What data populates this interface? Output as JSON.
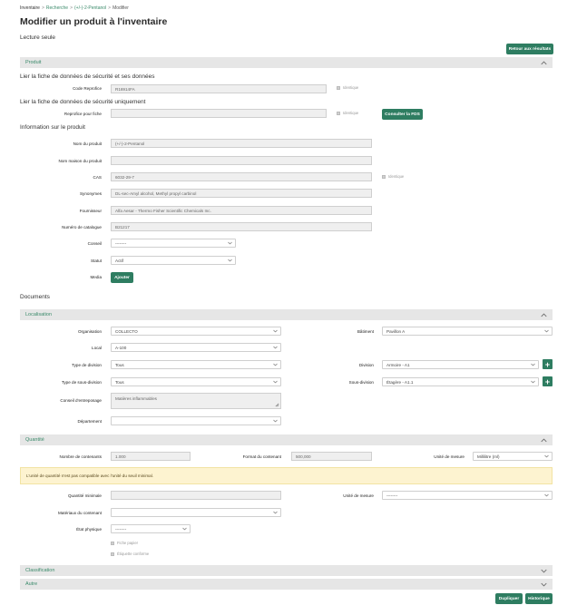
{
  "breadcrumb": {
    "items": [
      "Inventaire",
      "Recherche",
      "(+/-)-2-Pentanol"
    ],
    "current": "Modifier",
    "separator": ">"
  },
  "page": {
    "title": "Modifier un produit à l'inventaire",
    "subtitle": "Lecture seule",
    "back_button": "Retour aux résultats"
  },
  "produit": {
    "header": "Produit",
    "link_all": "Lier la fiche de données de sécurité et ses données",
    "code_reprofice_label": "Code Reprofice",
    "code_reprofice_value": "R16914FA",
    "identique": "Identique",
    "link_only": "Lier la fiche de données de sécurité uniquement",
    "reprofice_sds_label": "Reprofice pour fiche",
    "reprofice_sds_value": "",
    "consult_button": "Consulter la FDS",
    "info_title": "Information sur le produit",
    "fields": {
      "nom_label": "Nom du produit",
      "nom_value": "(+/-)-2-Pentanol",
      "maison_label": "Nom maison du produit",
      "maison_value": "",
      "cas_label": "CAS",
      "cas_value": "6032-29-7",
      "syn_label": "Synonymes",
      "syn_value": "DL-sec-Amyl alcohol, Methyl propyl carbinol",
      "four_label": "Fournisseur",
      "four_value": "Alfa Aesar - Thermo Fisher Scientific Chemicals Inc.",
      "cat_label": "Numéro de catalogue",
      "cat_value": "B21217",
      "conseil_label": "Conseil",
      "conseil_value": "--------",
      "statut_label": "Statut",
      "statut_value": "Actif",
      "media_label": "Media",
      "media_button": "Ajouter"
    }
  },
  "documents_title": "Documents",
  "localisation": {
    "header": "Localisation",
    "org_label": "Organisation",
    "org_value": "COLLECTO",
    "batiment_label": "Bâtiment",
    "batiment_value": "Pavillon A",
    "local_label": "Local",
    "local_value": "A-100",
    "typediv_label": "Type de division",
    "typediv_value": "Tous",
    "division_label": "Division",
    "division_value": "Armoire - A1",
    "typesousdiv_label": "Type de sous-division",
    "typesousdiv_value": "Tous",
    "sousdiv_label": "Sous-division",
    "sousdiv_value": "Étagère - A1.1",
    "conseil_entr_label": "Conseil d'entreposage",
    "conseil_entr_value": "Matières inflammables",
    "dept_label": "Département",
    "dept_value": ""
  },
  "quantite": {
    "header": "Quantité",
    "nb_label": "Nombre de contenants",
    "nb_value": "1.000",
    "format_label": "Format du contenant",
    "format_value": "500,000",
    "unite_label": "Unité de mesure",
    "unite_value": "Millilitre (ml)",
    "warning": "L'unité de quantité n'est pas compatible avec l'unité du seuil minimal.",
    "qmin_label": "Quantité minimale",
    "qmin_value": "",
    "unite2_label": "Unité de mesure",
    "unite2_value": "--------",
    "mat_label": "Matériaux du contenant",
    "mat_value": "",
    "etat_label": "État physique",
    "etat_value": "--------",
    "fiche_papier": "Fiche papier",
    "etiquette": "Étiquette conforme"
  },
  "classification": {
    "header": "Classification"
  },
  "autre": {
    "header": "Autre"
  },
  "footer": {
    "dupliquer": "Dupliquer",
    "historique": "Historique"
  },
  "colors": {
    "accent": "#2e7d61",
    "section_bg": "#e6e6e6",
    "warning_bg": "#fdf3d0"
  }
}
